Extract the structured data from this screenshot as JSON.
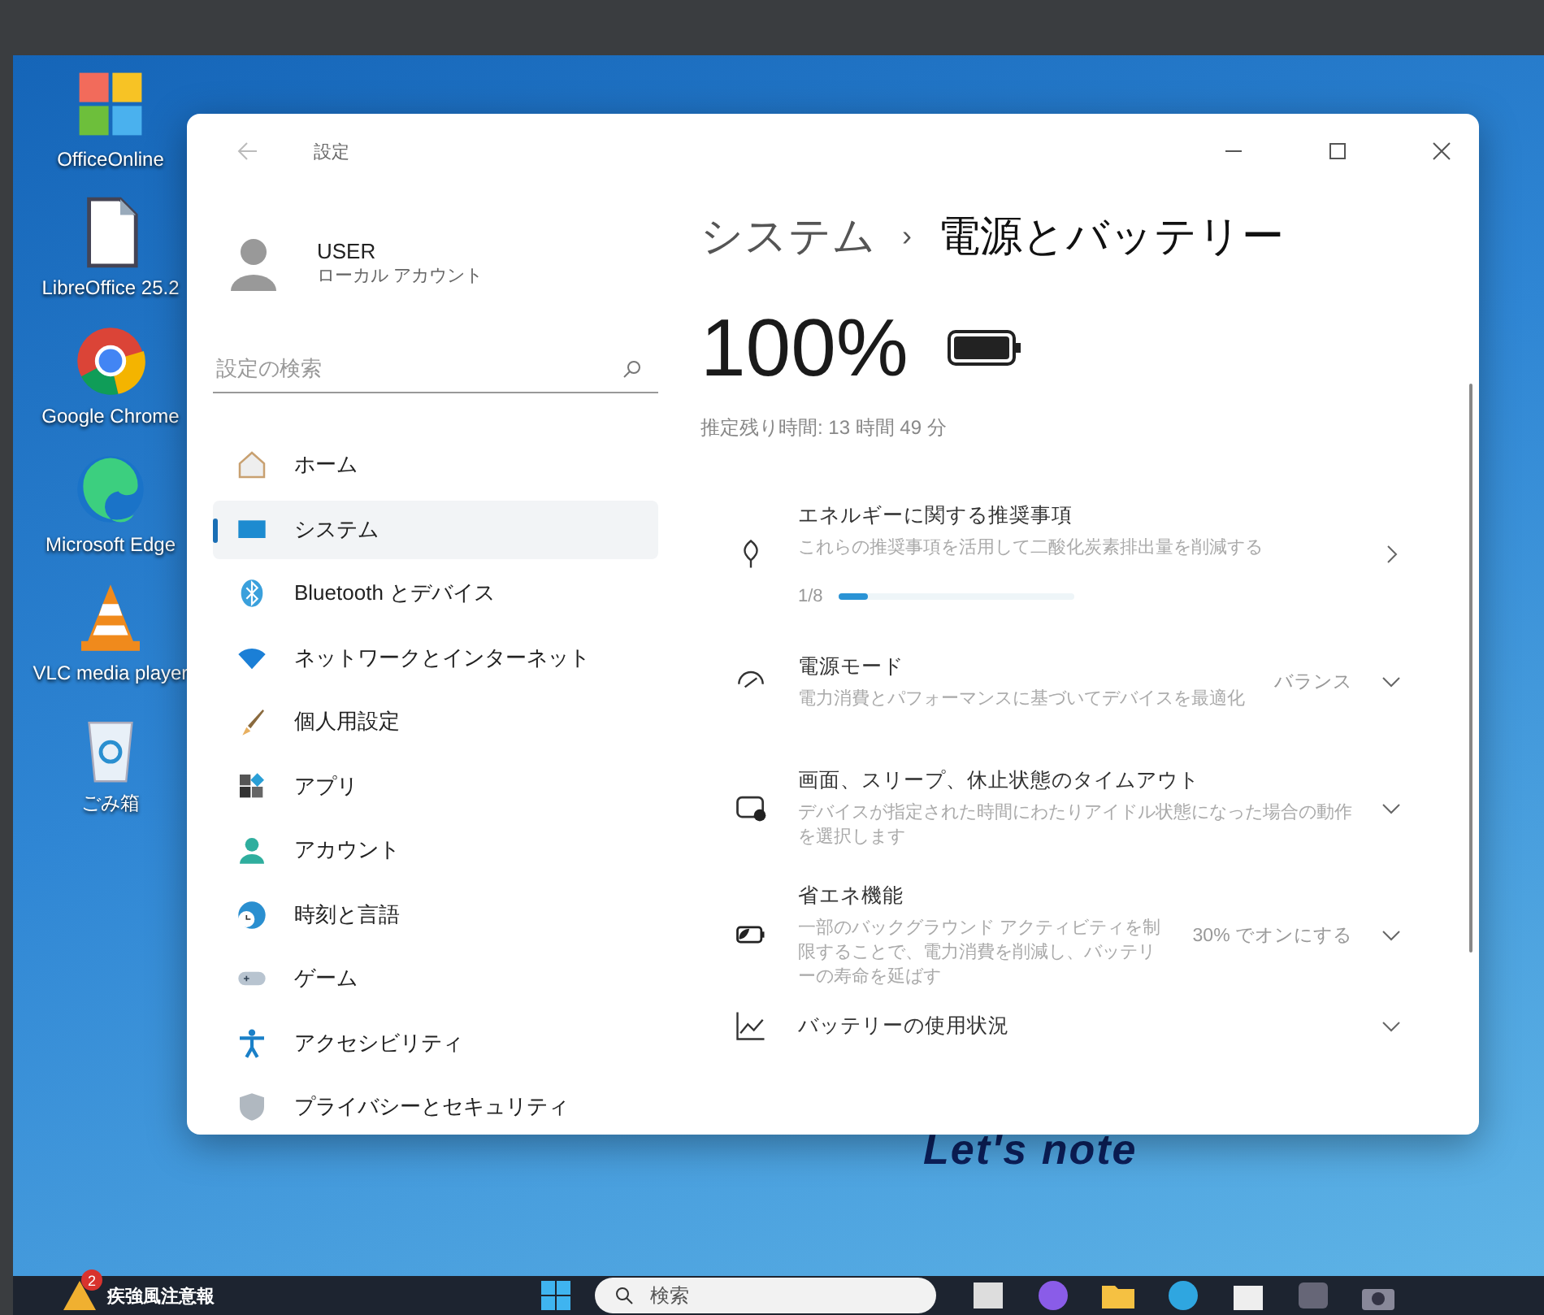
{
  "desktop_icons": [
    {
      "label": "OfficeOnline",
      "kind": "office"
    },
    {
      "label": "LibreOffice 25.2",
      "kind": "document"
    },
    {
      "label": "Google Chrome",
      "kind": "chrome"
    },
    {
      "label": "Microsoft Edge",
      "kind": "edge"
    },
    {
      "label": "VLC media player",
      "kind": "cone"
    },
    {
      "label": "ごみ箱",
      "kind": "bin"
    }
  ],
  "wallpaper_logo": "Let's note",
  "window": {
    "title": "設定"
  },
  "user": {
    "name": "USER",
    "account": "ローカル アカウント"
  },
  "search": {
    "placeholder": "設定の検索"
  },
  "sidebar": {
    "items": [
      {
        "label": "ホーム",
        "selected": false
      },
      {
        "label": "システム",
        "selected": true
      },
      {
        "label": "Bluetooth とデバイス",
        "selected": false
      },
      {
        "label": "ネットワークとインターネット",
        "selected": false
      },
      {
        "label": "個人用設定",
        "selected": false
      },
      {
        "label": "アプリ",
        "selected": false
      },
      {
        "label": "アカウント",
        "selected": false
      },
      {
        "label": "時刻と言語",
        "selected": false
      },
      {
        "label": "ゲーム",
        "selected": false
      },
      {
        "label": "アクセシビリティ",
        "selected": false
      },
      {
        "label": "プライバシーとセキュリティ",
        "selected": false
      }
    ]
  },
  "breadcrumb": {
    "parent": "システム",
    "separator": "›",
    "current": "電源とバッテリー"
  },
  "battery": {
    "percent": "100%",
    "level": 1,
    "estimate": "推定残り時間: 13 時間 49 分"
  },
  "settings": [
    {
      "kind": "progress",
      "title": "エネルギーに関する推奨事項",
      "description": "これらの推奨事項を活用して二酸化炭素排出量を削減する",
      "count": "1/8",
      "level": 0.125
    },
    {
      "kind": "dropdown",
      "title": "電源モード",
      "description": "電力消費とパフォーマンスに基づいてデバイスを最適化",
      "value": "バランス"
    },
    {
      "kind": "dropdown",
      "title": "画面、スリープ、休止状態のタイムアウト",
      "description": "デバイスが指定された時間にわたりアイドル状態になった場合の動作を選択します"
    },
    {
      "kind": "dropdown",
      "title": "省エネ機能",
      "description": "一部のバックグラウンド アクティビティを制限することで、電力消費を削減し、バッテリーの寿命を延ばす",
      "value": "30% でオンにする"
    },
    {
      "kind": "dropdown",
      "title": "バッテリーの使用状況"
    }
  ],
  "taskbar": {
    "weather_badge": "2",
    "weather_text": "疾強風注意報",
    "search_placeholder": "検索"
  }
}
